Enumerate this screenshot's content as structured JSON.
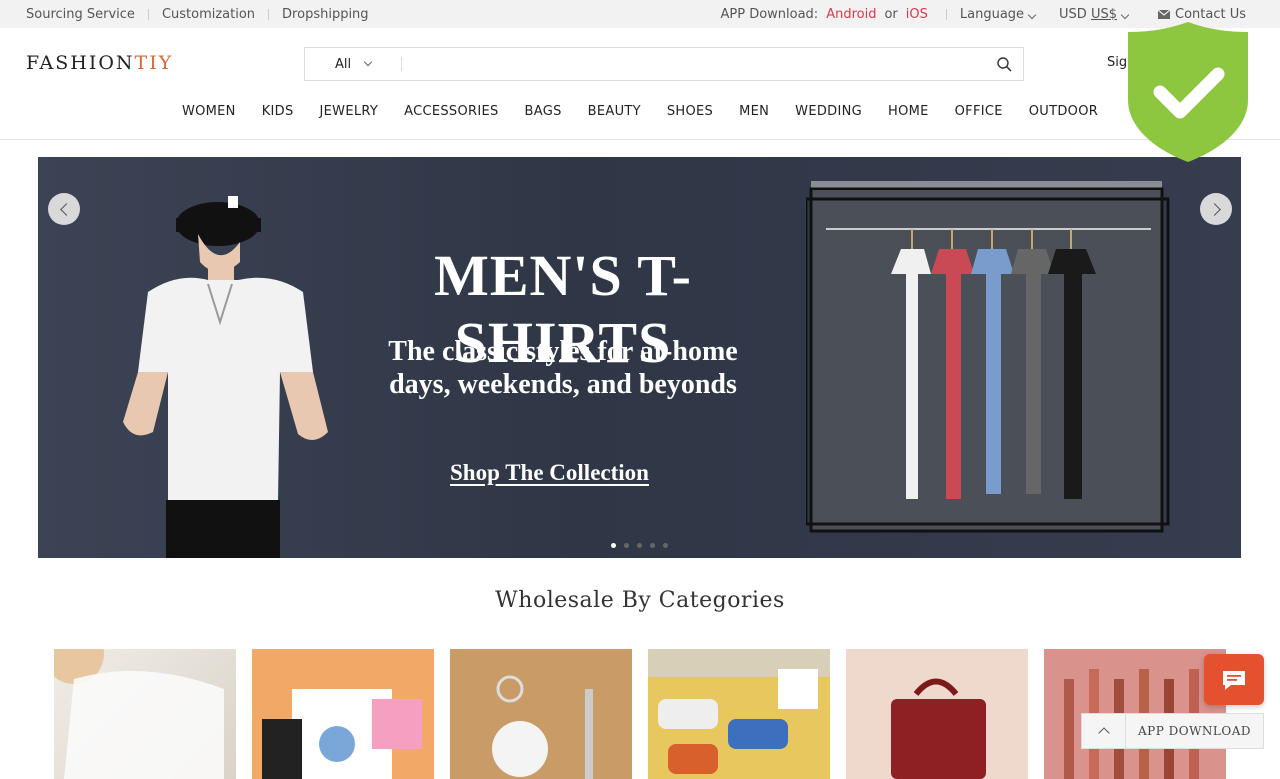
{
  "topbar": {
    "links": [
      "Sourcing Service",
      "Customization",
      "Dropshipping"
    ],
    "app_download_label": "APP Download:",
    "android": "Android",
    "or": "or",
    "ios": "iOS",
    "language": "Language",
    "currency_prefix": "USD",
    "currency": "US$",
    "contact": "Contact Us"
  },
  "header": {
    "logo_main": "FASHION",
    "logo_accent": "TIY",
    "search_scope": "All",
    "search_placeholder": "",
    "signin": "Sig"
  },
  "nav": [
    "WOMEN",
    "KIDS",
    "JEWELRY",
    "ACCESSORIES",
    "BAGS",
    "BEAUTY",
    "SHOES",
    "MEN",
    "WEDDING",
    "HOME",
    "OFFICE",
    "OUTDOOR"
  ],
  "hero": {
    "title": "MEN'S T-SHIRTS",
    "sub_line1": "The classic styles for at-home",
    "sub_line2": "days, weekends, and beyonds",
    "cta": "Shop The Collection",
    "slide_count": 5,
    "active_slide": 1
  },
  "categories": {
    "title": "Wholesale By Categories",
    "tiles": [
      "women-apparel-tile",
      "kids-apparel-tile",
      "jewelry-keychain-tile",
      "socks-tile",
      "bags-tile",
      "beauty-lipstick-tile"
    ]
  },
  "floating": {
    "app_download": "APP DOWNLOAD"
  },
  "colors": {
    "accent": "#d63a4a",
    "logo_accent": "#d8683a",
    "chat": "#e5502f",
    "badge": "#8dc63f"
  }
}
